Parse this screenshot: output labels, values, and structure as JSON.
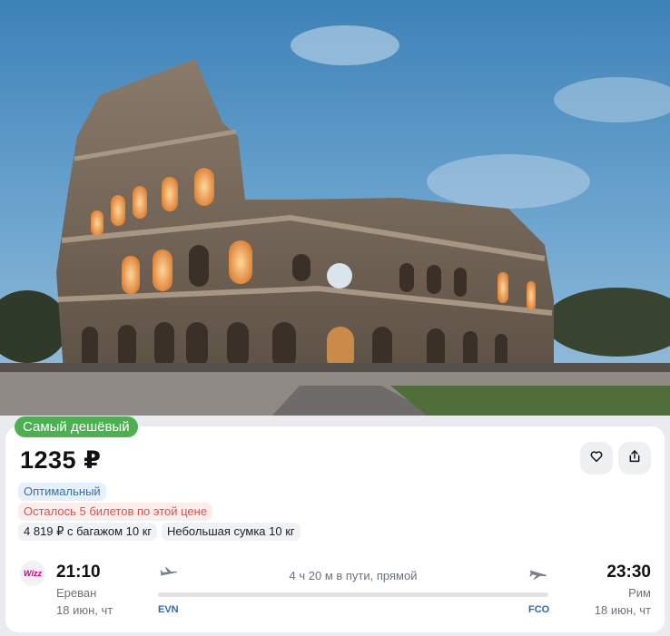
{
  "hero": {
    "image": "colosseum-photo"
  },
  "badge": {
    "label": "Самый дешёвый",
    "color": "#4caf50"
  },
  "offer": {
    "price": "1235 ₽",
    "tags": {
      "optimal": "Оптимальный",
      "tickets_left": "Осталось 5 билетов по этой цене",
      "with_baggage": "4 819 ₽ с багажом 10 кг",
      "small_bag": "Небольшая сумка 10 кг"
    },
    "actions": {
      "favorite_icon": "heart-icon",
      "share_icon": "share-icon"
    }
  },
  "flight": {
    "airline_logo": "Wizz",
    "departure": {
      "time": "21:10",
      "city": "Ереван",
      "date": "18 июн, чт",
      "iata": "EVN"
    },
    "arrival": {
      "time": "23:30",
      "city": "Рим",
      "date": "18 июн, чт",
      "iata": "FCO"
    },
    "duration_text": "4 ч 20 м в пути, прямой"
  },
  "colors": {
    "accent_green": "#4caf50",
    "warning_red": "#d9534f",
    "iata_blue": "#2f6bb3"
  }
}
